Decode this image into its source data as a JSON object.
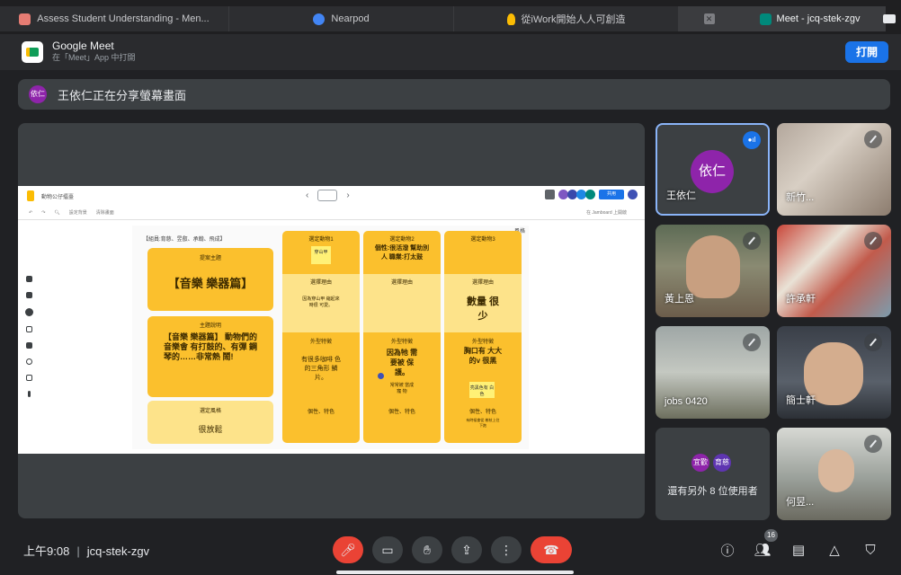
{
  "tabs": [
    {
      "title": "Assess Student Understanding - Men...",
      "icon": "nearpod-multicolor-icon",
      "color": "#e67c73"
    },
    {
      "title": "Nearpod",
      "icon": "nearpod-icon",
      "color": "#4285f4"
    },
    {
      "title": "從iWork開始人人可創造",
      "icon": "lightbulb-icon",
      "color": "#fbbc04"
    },
    {
      "title": "Meet - jcq-stek-zgv",
      "icon": "google-meet-icon",
      "color": "#00897b"
    }
  ],
  "banner": {
    "app_name": "Google Meet",
    "subtitle": "在「Meet」App 中打開",
    "open_label": "打開"
  },
  "presenting": {
    "avatar": "依仁",
    "text": "王依仁正在分享螢幕畫面"
  },
  "jamboard": {
    "file_name": "動物公仔擂臺",
    "share_label": "共用",
    "toolbar_items": [
      "設定背景",
      "清除畫面"
    ],
    "open_in_jamboard": "在 Jamboard 上開啟",
    "team_title": "【組員:育慈、昱叡、承翰、飛成】",
    "corner_label": "風格",
    "theme_header": "提案主題",
    "theme_value": "【音樂 樂器篇】",
    "desc_header": "主題說明",
    "desc_value": "【音樂 樂器篇】 動物們的音樂會 有打鼓的、有彈 鋼琴的……非常熱 鬧!",
    "style_header": "選定風格",
    "style_value": "很放鬆",
    "columns": [
      {
        "animal_label": "選定動物1",
        "animal_note": "穿山甲",
        "reason_label": "選擇理由",
        "reason": "因為穿山甲 縮起來時很 可愛。",
        "feature_label": "外型特徵",
        "feature": "有很多咖啡 色的三角形 鱗片。",
        "trait_label": "個性、特色"
      },
      {
        "animal_label": "選定動物2",
        "animal_note": "個性:很活潑 幫助別人 職業:打太鼓",
        "reason_label": "選擇理由",
        "reason": "",
        "feature_label": "外型特徵",
        "feature": "因為牠 需要被 保護。",
        "feature_note": "常常被 當成寵 物",
        "trait_label": "個性、特色"
      },
      {
        "animal_label": "選定動物3",
        "animal_note": "",
        "reason_label": "選擇理由",
        "reason": "數量 很少",
        "feature_label": "外型特徵",
        "feature": "胸口有 大大的v 很黑",
        "feature_note": "亮黑色有 白色",
        "trait_label": "個性、特色",
        "trait_note": "有時候會從 樹枝上往 下跑"
      }
    ]
  },
  "participants": [
    {
      "name": "王依仁",
      "avatar": "依仁",
      "speaking": true,
      "muted": false
    },
    {
      "name": "新竹...",
      "muted": true
    },
    {
      "name": "黃上恩",
      "muted": true
    },
    {
      "name": "許承軒",
      "muted": true
    },
    {
      "name": "jobs 0420",
      "muted": true
    },
    {
      "name": "簡士軒",
      "muted": true
    },
    {
      "name": "何昱...",
      "muted": true
    }
  ],
  "others": {
    "avatars": [
      "宜歡",
      "育慈"
    ],
    "text": "還有另外 8 位使用者"
  },
  "bottom": {
    "time": "上午9:08",
    "meeting_code": "jcq-stek-zgv",
    "people_count": "16"
  },
  "colors": {
    "end_call": "#ea4335",
    "accent": "#1a73e8",
    "sticky": "#fbc02d",
    "background": "#202124"
  }
}
